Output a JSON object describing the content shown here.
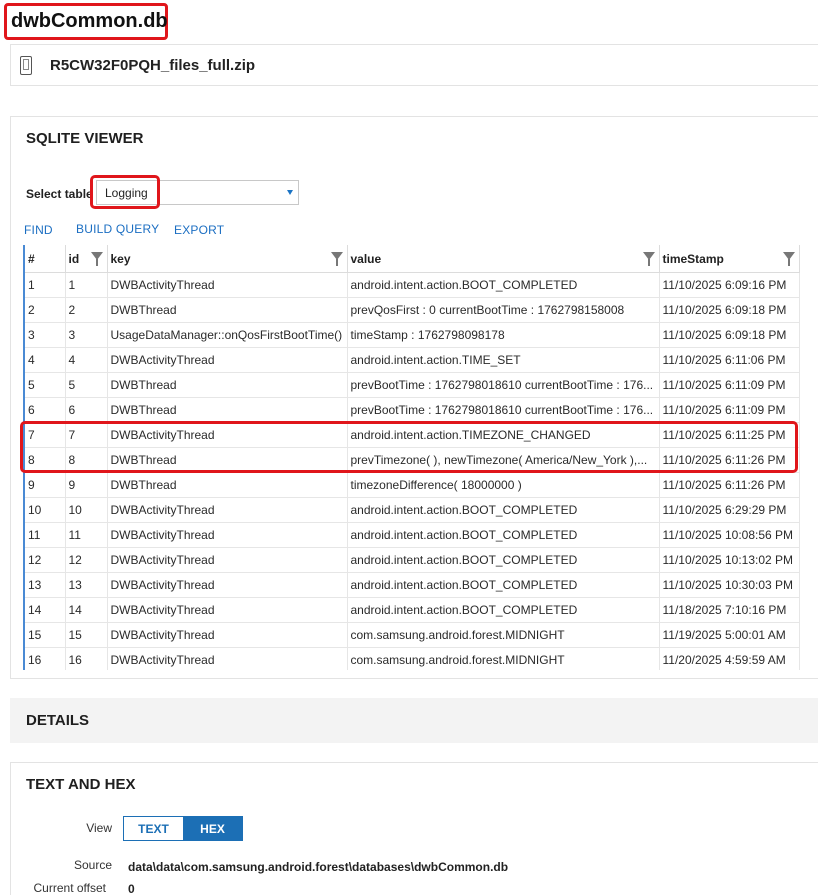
{
  "db_title": "dwbCommon.db",
  "file_name": "R5CW32F0PQH_files_full.zip",
  "viewer": {
    "title": "SQLITE VIEWER",
    "select_label": "Select table",
    "selected_table": "Logging",
    "toolbar": {
      "find": "FIND",
      "build_query": "BUILD QUERY",
      "export": "EXPORT"
    },
    "columns": [
      "#",
      "id",
      "key",
      "value",
      "timeStamp"
    ],
    "rows": [
      [
        "1",
        "1",
        "DWBActivityThread",
        "android.intent.action.BOOT_COMPLETED",
        "11/10/2025 6:09:16 PM"
      ],
      [
        "2",
        "2",
        "DWBThread",
        "prevQosFirst : 0 currentBootTime : 1762798158008",
        "11/10/2025 6:09:18 PM"
      ],
      [
        "3",
        "3",
        "UsageDataManager::onQosFirstBootTime()",
        "timeStamp : 1762798098178",
        "11/10/2025 6:09:18 PM"
      ],
      [
        "4",
        "4",
        "DWBActivityThread",
        "android.intent.action.TIME_SET",
        "11/10/2025 6:11:06 PM"
      ],
      [
        "5",
        "5",
        "DWBThread",
        "prevBootTime : 1762798018610 currentBootTime : 176...",
        "11/10/2025 6:11:09 PM"
      ],
      [
        "6",
        "6",
        "DWBThread",
        "prevBootTime : 1762798018610 currentBootTime : 176...",
        "11/10/2025 6:11:09 PM"
      ],
      [
        "7",
        "7",
        "DWBActivityThread",
        "android.intent.action.TIMEZONE_CHANGED",
        "11/10/2025 6:11:25 PM"
      ],
      [
        "8",
        "8",
        "DWBThread",
        "prevTimezone(  ), newTimezone( America/New_York ),...",
        "11/10/2025 6:11:26 PM"
      ],
      [
        "9",
        "9",
        "DWBThread",
        "timezoneDifference( 18000000 )",
        "11/10/2025 6:11:26 PM"
      ],
      [
        "10",
        "10",
        "DWBActivityThread",
        "android.intent.action.BOOT_COMPLETED",
        "11/10/2025 6:29:29 PM"
      ],
      [
        "11",
        "11",
        "DWBActivityThread",
        "android.intent.action.BOOT_COMPLETED",
        "11/10/2025 10:08:56 PM"
      ],
      [
        "12",
        "12",
        "DWBActivityThread",
        "android.intent.action.BOOT_COMPLETED",
        "11/10/2025 10:13:02 PM"
      ],
      [
        "13",
        "13",
        "DWBActivityThread",
        "android.intent.action.BOOT_COMPLETED",
        "11/10/2025 10:30:03 PM"
      ],
      [
        "14",
        "14",
        "DWBActivityThread",
        "android.intent.action.BOOT_COMPLETED",
        "11/18/2025 7:10:16 PM"
      ],
      [
        "15",
        "15",
        "DWBActivityThread",
        "com.samsung.android.forest.MIDNIGHT",
        "11/19/2025 5:00:01 AM"
      ],
      [
        "16",
        "16",
        "DWBActivityThread",
        "com.samsung.android.forest.MIDNIGHT",
        "11/20/2025 4:59:59 AM"
      ]
    ]
  },
  "details": {
    "title": "DETAILS"
  },
  "text_hex": {
    "title": "TEXT AND HEX",
    "view_label": "View",
    "text_btn": "TEXT",
    "hex_btn": "HEX",
    "source_label": "Source",
    "source_value": "data\\data\\com.samsung.android.forest\\databases\\dwbCommon.db",
    "offset_label": "Current offset",
    "offset_value": "0"
  },
  "colors": {
    "accent": "#1c6fb5",
    "highlight": "#e0161b"
  }
}
